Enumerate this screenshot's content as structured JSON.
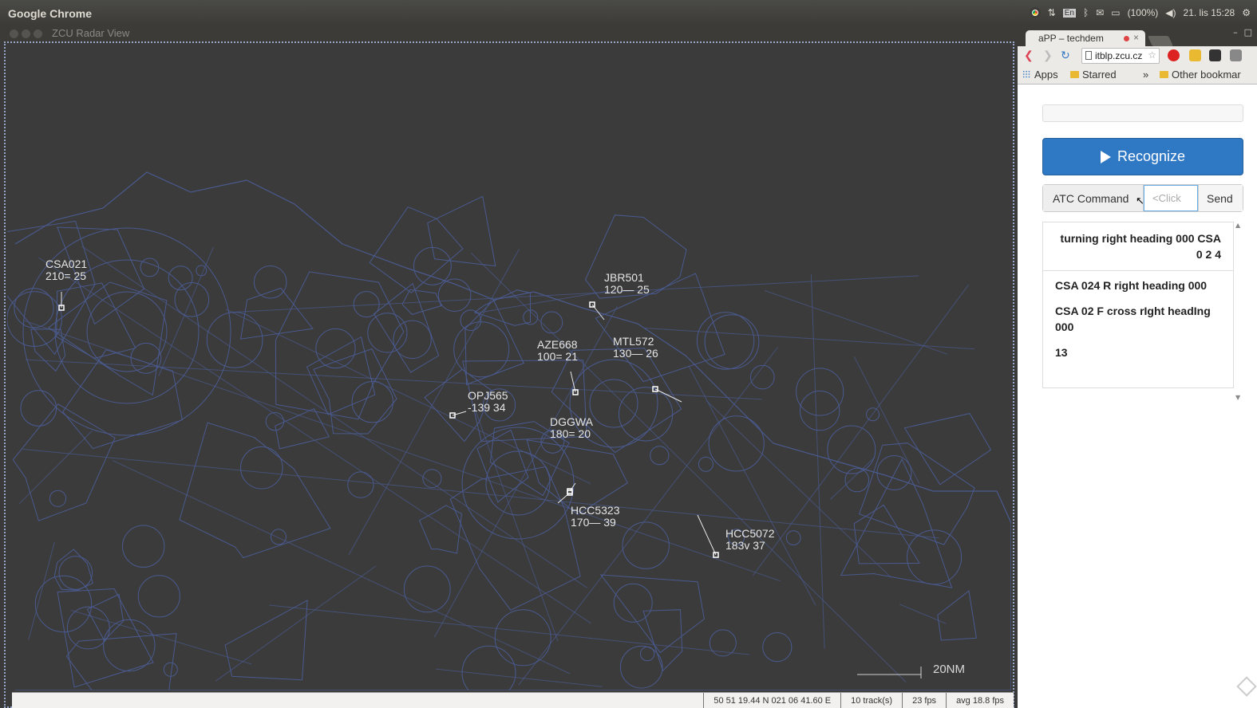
{
  "system_bar": {
    "app_name": "Google Chrome",
    "tray": {
      "lang": "En",
      "battery": "(100%)",
      "clock": "21. lis 15:28"
    }
  },
  "radar_window": {
    "title": "ZCU Radar View",
    "map_color": "#4a5a8f",
    "scale_label": "20NM",
    "aircraft": [
      {
        "callsign": "CSA021",
        "data": "210= 25"
      },
      {
        "callsign": "JBR501",
        "data": "120— 25"
      },
      {
        "callsign": "AZE668",
        "data": "100= 21"
      },
      {
        "callsign": "MTL572",
        "data": "130— 26"
      },
      {
        "callsign": "OPJ565",
        "data": "-139 34"
      },
      {
        "callsign": "DGGWA",
        "data": "180= 20"
      },
      {
        "callsign": "HCC5323",
        "data": "170— 39"
      },
      {
        "callsign": "HCC5072",
        "data": "183v 37"
      }
    ],
    "status": {
      "coords": "50 51 19.44 N 021 06 41.60 E",
      "tracks": "10 track(s)",
      "fps": "23 fps",
      "avg_fps": "avg 18.8 fps"
    }
  },
  "browser": {
    "tab_title": "aPP – techdem",
    "tab_close": "×",
    "address": "itblp.zcu.cz",
    "bookmarks": {
      "apps": "Apps",
      "starred": "Starred",
      "more": "»",
      "other": "Other bookmar"
    },
    "recognize_label": "Recognize",
    "atc_label": "ATC Command",
    "atc_input_placeholder": "<Click",
    "send_label": "Send",
    "results": [
      "turning right heading 000 CSA 0 2 4",
      "CSA 024 R right heading 000",
      "CSA 02 F cross rIght headIng 000",
      "13"
    ]
  }
}
